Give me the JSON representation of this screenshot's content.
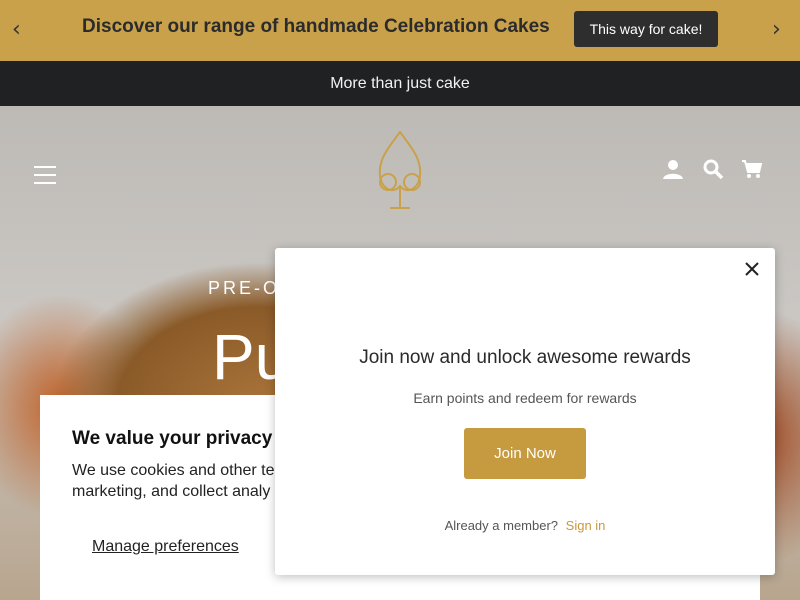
{
  "announcement": {
    "prev_arrow": "‹",
    "next_arrow": "›",
    "message": "Discover our range of handmade Celebration Cakes",
    "cta_label": "This way for cake!"
  },
  "tagline": "More than just cake",
  "header": {
    "icons": [
      "menu-icon",
      "logo",
      "account-icon",
      "search-icon",
      "cart-icon"
    ]
  },
  "hero": {
    "pre_title": "PRE-OR",
    "title": "Pu"
  },
  "cookie_banner": {
    "title": "We value your privacy",
    "body_line1": "We use cookies and other te",
    "body_line2": "marketing, and collect analy",
    "manage_label": "Manage preferences"
  },
  "rewards_popup": {
    "headline": "Join now and unlock awesome rewards",
    "subtext": "Earn points and redeem for rewards",
    "join_label": "Join Now",
    "member_prompt": "Already a member?",
    "signin_label": "Sign in"
  },
  "colors": {
    "gold": "#c9a14a",
    "dark": "#1f2122",
    "button_gold": "#c69a3e"
  }
}
